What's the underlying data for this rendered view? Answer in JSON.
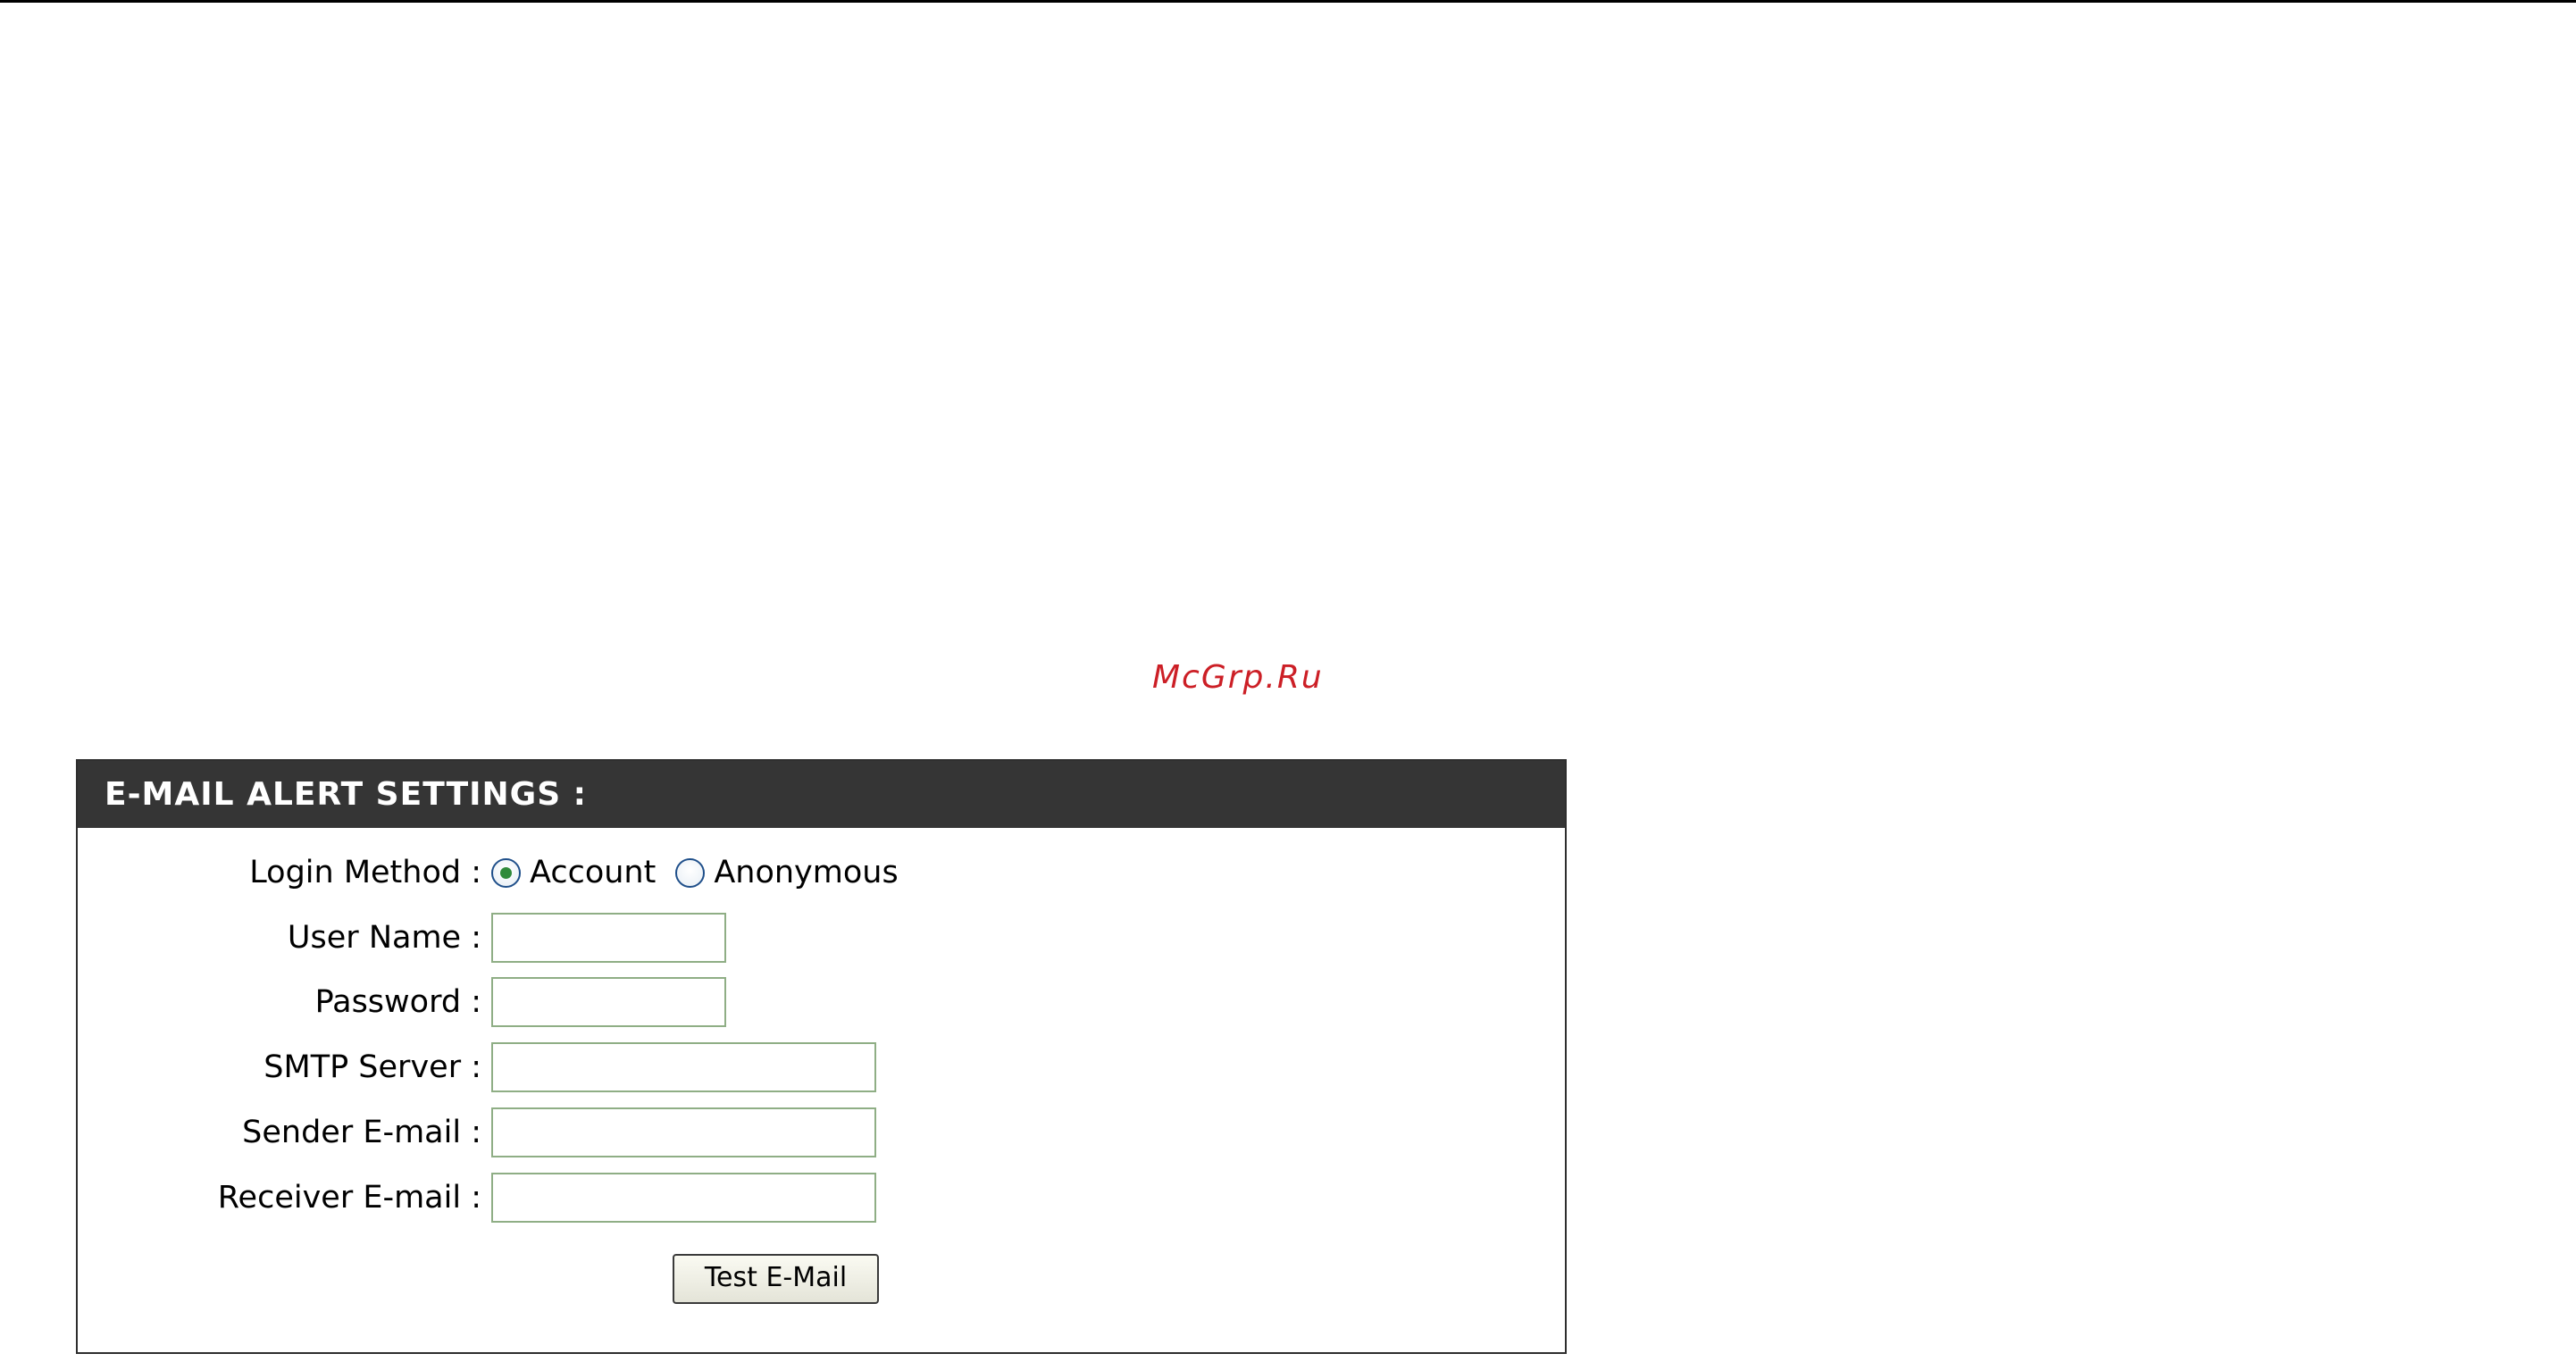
{
  "watermark": "McGrp.Ru",
  "panel": {
    "title": "E-MAIL ALERT SETTINGS :",
    "login_method": {
      "label": "Login Method :",
      "options": [
        {
          "label": "Account",
          "selected": true
        },
        {
          "label": "Anonymous",
          "selected": false
        }
      ]
    },
    "fields": {
      "user_name": {
        "label": "User Name :",
        "value": ""
      },
      "password": {
        "label": "Password :",
        "value": ""
      },
      "smtp_server": {
        "label": "SMTP Server :",
        "value": ""
      },
      "sender_email": {
        "label": "Sender E-mail :",
        "value": ""
      },
      "receiver_email": {
        "label": "Receiver E-mail :",
        "value": ""
      }
    },
    "test_button_label": "Test E-Mail"
  },
  "colors": {
    "header_bg": "#353535",
    "watermark": "#cc1f26",
    "input_border": "#8fae85",
    "radio_dot": "#2f8a3a"
  }
}
